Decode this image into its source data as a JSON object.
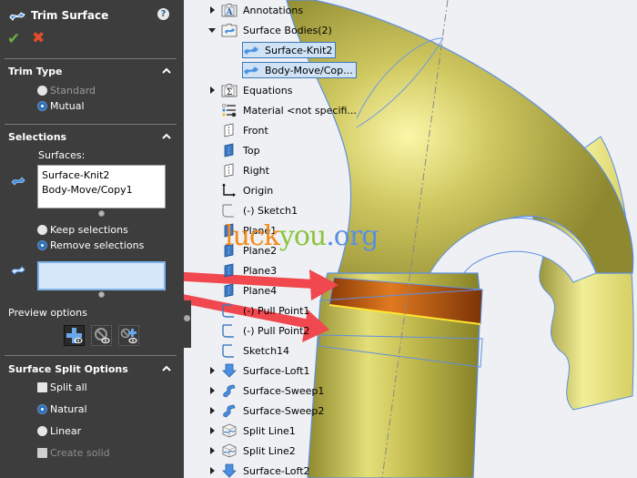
{
  "property_manager": {
    "title": "Trim Surface",
    "help_icon": "help-icon",
    "ok_icon": "checkmark-icon",
    "cancel_icon": "x-icon",
    "trim_type": {
      "header": "Trim Type",
      "options": [
        {
          "label": "Standard",
          "selected": false,
          "enabled": false
        },
        {
          "label": "Mutual",
          "selected": true,
          "enabled": true
        }
      ]
    },
    "selections": {
      "header": "Selections",
      "surfaces_label": "Surfaces:",
      "surfaces": [
        "Surface-Knit2",
        "Body-Move/Copy1"
      ],
      "keep_options": [
        {
          "label": "Keep selections",
          "selected": false
        },
        {
          "label": "Remove selections",
          "selected": true
        }
      ],
      "pieces_value": ""
    },
    "preview": {
      "label": "Preview options",
      "buttons": [
        {
          "name": "show-included-surfaces",
          "active": true
        },
        {
          "name": "show-excluded-surfaces",
          "active": false
        },
        {
          "name": "show-included-and-excluded-surfaces",
          "active": false
        }
      ]
    },
    "split_options": {
      "header": "Surface Split Options",
      "split_all": {
        "label": "Split all",
        "checked": false
      },
      "options": [
        {
          "label": "Natural",
          "selected": true
        },
        {
          "label": "Linear",
          "selected": false
        }
      ],
      "create_solid": {
        "label": "Create solid",
        "checked": false,
        "enabled": false
      }
    }
  },
  "feature_tree": {
    "items": [
      {
        "label": "Annotations",
        "icon": "annotations-folder-icon",
        "expander": "collapsed"
      },
      {
        "label": "Surface Bodies(2)",
        "icon": "surface-bodies-folder-icon",
        "expander": "expanded"
      },
      {
        "label": "Surface-Knit2",
        "icon": "surface-body-icon",
        "selected": true
      },
      {
        "label": "Body-Move/Cop...",
        "icon": "surface-body-icon",
        "selected": true
      },
      {
        "label": "Equations",
        "icon": "equations-folder-icon",
        "expander": "collapsed"
      },
      {
        "label": "Material <not specifi...",
        "icon": "material-icon"
      },
      {
        "label": "Front",
        "icon": "plane-icon"
      },
      {
        "label": "Top",
        "icon": "plane-icon"
      },
      {
        "label": "Right",
        "icon": "plane-icon"
      },
      {
        "label": "Origin",
        "icon": "origin-icon"
      },
      {
        "label": "(-) Sketch1",
        "icon": "sketch-icon"
      },
      {
        "label": "Plane1",
        "icon": "plane-icon"
      },
      {
        "label": "Plane2",
        "icon": "plane-icon"
      },
      {
        "label": "Plane3",
        "icon": "plane-icon"
      },
      {
        "label": "Plane4",
        "icon": "plane-icon"
      },
      {
        "label": "(-) Pull Point1",
        "icon": "sketch-icon"
      },
      {
        "label": "(-) Pull Point2",
        "icon": "sketch-icon"
      },
      {
        "label": "Sketch14",
        "icon": "sketch-icon"
      },
      {
        "label": "Surface-Loft1",
        "icon": "loft-icon",
        "expander": "collapsed"
      },
      {
        "label": "Surface-Sweep1",
        "icon": "sweep-icon",
        "expander": "collapsed"
      },
      {
        "label": "Surface-Sweep2",
        "icon": "sweep-icon",
        "expander": "collapsed"
      },
      {
        "label": "Split Line1",
        "icon": "split-line-icon",
        "expander": "collapsed"
      },
      {
        "label": "Split Line2",
        "icon": "split-line-icon",
        "expander": "collapsed"
      },
      {
        "label": "Surface-Loft2",
        "icon": "loft-icon",
        "expander": "collapsed"
      }
    ]
  },
  "watermark": {
    "part1": "luck",
    "part2": "you",
    "part3": ".org"
  },
  "colors": {
    "panel_bg": "#3d3d3d",
    "accent_blue": "#2f6fb8",
    "surface_yellow": "#c9c25a",
    "trim_highlight": "#b8520f",
    "arrow_red": "#f0484e"
  }
}
